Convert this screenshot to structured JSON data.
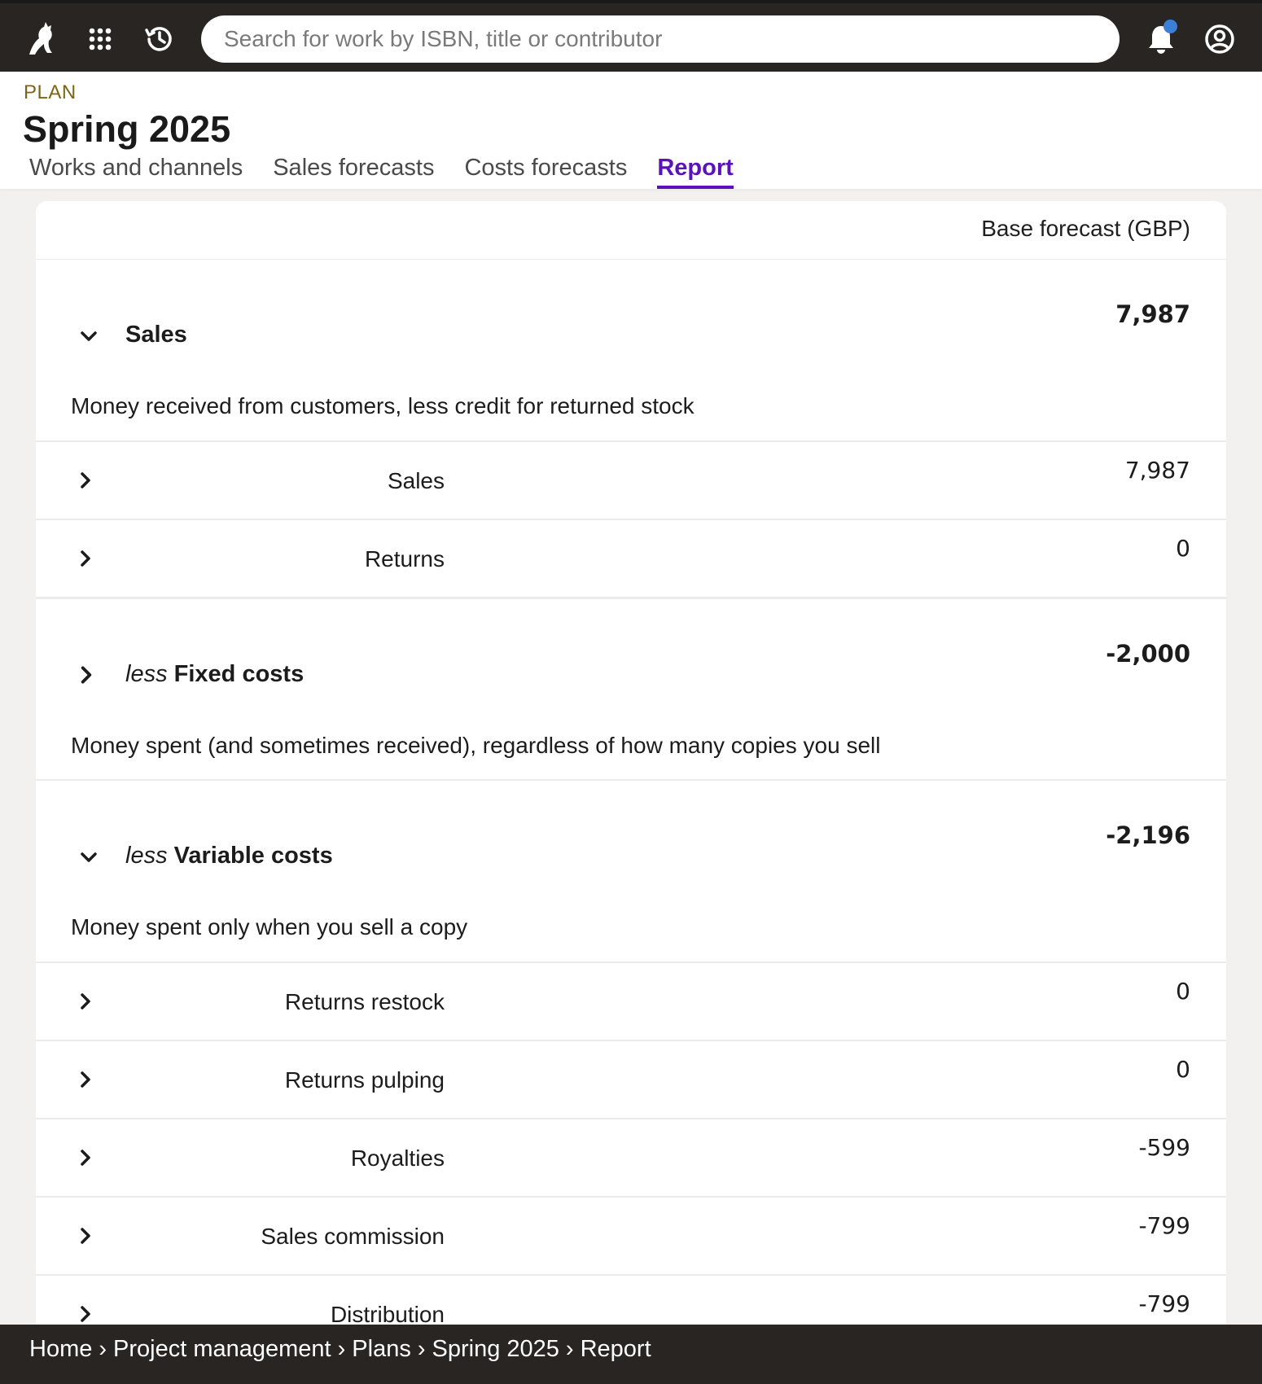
{
  "search": {
    "placeholder": "Search for work by ISBN, title or contributor",
    "value": ""
  },
  "header": {
    "eyebrow": "PLAN",
    "title": "Spring 2025",
    "tabs": [
      {
        "label": "Works and channels",
        "active": false
      },
      {
        "label": "Sales forecasts",
        "active": false
      },
      {
        "label": "Costs forecasts",
        "active": false
      },
      {
        "label": "Report",
        "active": true
      }
    ]
  },
  "report": {
    "column_header": "Base forecast (GBP)",
    "sales": {
      "prefix": "",
      "label": "Sales",
      "value": "7,987",
      "description": "Money received from customers, less credit for returned stock",
      "expanded": true,
      "rows": [
        {
          "label": "Sales",
          "value": "7,987"
        },
        {
          "label": "Returns",
          "value": "0"
        }
      ]
    },
    "fixed": {
      "prefix": "less",
      "label": "Fixed costs",
      "value": "-2,000",
      "description": "Money spent (and sometimes received), regardless of how many copies you sell",
      "expanded": false
    },
    "variable": {
      "prefix": "less",
      "label": "Variable costs",
      "value": "-2,196",
      "description": "Money spent only when you sell a copy",
      "expanded": true,
      "rows": [
        {
          "label": "Returns restock",
          "value": "0"
        },
        {
          "label": "Returns pulping",
          "value": "0"
        },
        {
          "label": "Royalties",
          "value": "-599"
        },
        {
          "label": "Sales commission",
          "value": "-799"
        },
        {
          "label": "Distribution",
          "value": "-799"
        }
      ]
    }
  },
  "breadcrumb": {
    "separator": "›",
    "items": [
      "Home",
      "Project management",
      "Plans",
      "Spring 2025",
      "Report"
    ]
  },
  "colors": {
    "topbar": "#282523",
    "accent": "#5b12b8",
    "eyebrow": "#7c6614",
    "notification_dot": "#3b7fd6"
  }
}
